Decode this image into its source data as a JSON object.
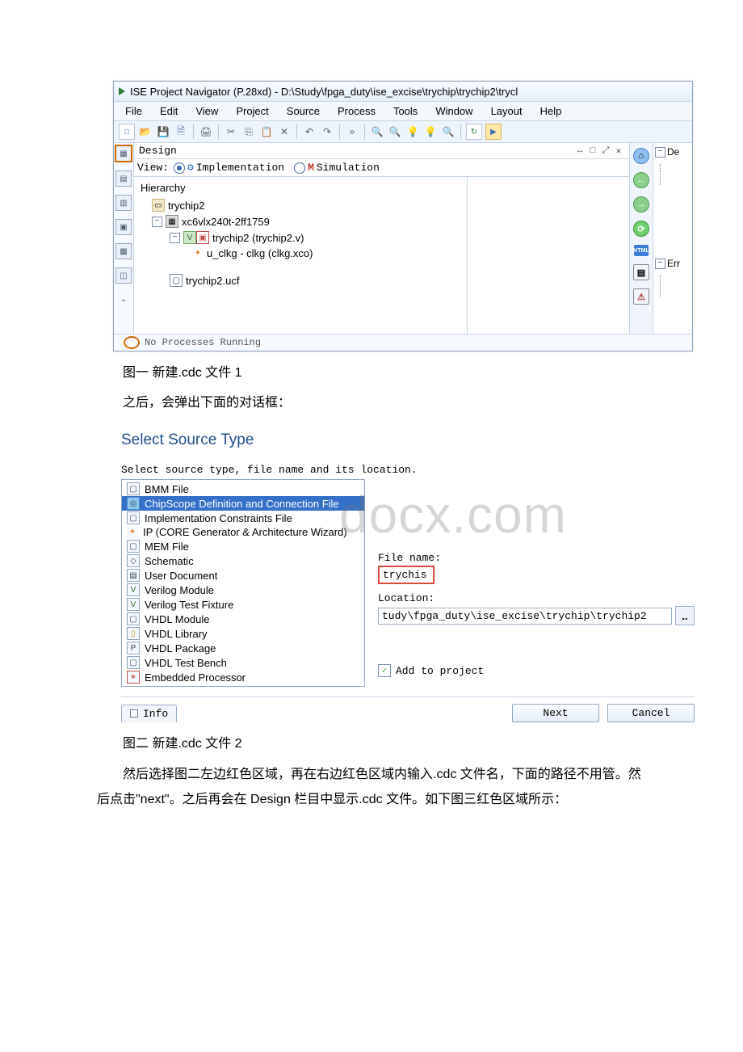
{
  "ise": {
    "title": "ISE Project Navigator (P.28xd) - D:\\Study\\fpga_duty\\ise_excise\\trychip\\trychip2\\trycl",
    "menu": {
      "file": "File",
      "edit": "Edit",
      "view": "View",
      "project": "Project",
      "source": "Source",
      "process": "Process",
      "tools": "Tools",
      "window": "Window",
      "layout": "Layout",
      "help": "Help"
    },
    "panel": {
      "design": "Design",
      "viewLabel": "View:",
      "impl": "Implementation",
      "sim": "Simulation",
      "hierarchy": "Hierarchy"
    },
    "tree": {
      "proj": "trychip2",
      "device": "xc6vlx240t-2ff1759",
      "top": "trychip2 (trychip2.v)",
      "ip": "u_clkg - clkg (clkg.xco)",
      "ucf": "trychip2.ucf"
    },
    "right": {
      "de": "De",
      "err": "Err"
    },
    "status": "No Processes Running"
  },
  "captions": {
    "one": "图一 新建.cdc 文件 1",
    "mid": "之后，会弹出下面的对话框：",
    "two": "图二 新建.cdc 文件 2",
    "after": "然后选择图二左边红色区域，再在右边红色区域内输入.cdc 文件名，下面的路径不用管。然后点击\"next\"。之后再会在 Design 栏目中显示.cdc 文件。如下图三红色区域所示："
  },
  "wizard": {
    "title": "Select Source Type",
    "sub": "Select source type, file name and its location.",
    "types": {
      "bmm": "BMM File",
      "cdc": "ChipScope Definition and Connection File",
      "ucf": "Implementation Constraints File",
      "ip": "IP (CORE Generator & Architecture Wizard)",
      "mem": "MEM File",
      "sch": "Schematic",
      "udoc": "User Document",
      "vmod": "Verilog Module",
      "vtf": "Verilog Test Fixture",
      "vhdm": "VHDL Module",
      "vhdl": "VHDL Library",
      "vhdp": "VHDL Package",
      "vhdtb": "VHDL Test Bench",
      "emb": "Embedded Processor"
    },
    "fileNameLabel": "File name:",
    "fileName": "trychis",
    "locationLabel": "Location:",
    "location": "tudy\\fpga_duty\\ise_excise\\trychip\\trychip2",
    "addToProject": "Add to project",
    "info": "Info",
    "next": "Next",
    "cancel": "Cancel"
  },
  "watermark": "docx.com"
}
